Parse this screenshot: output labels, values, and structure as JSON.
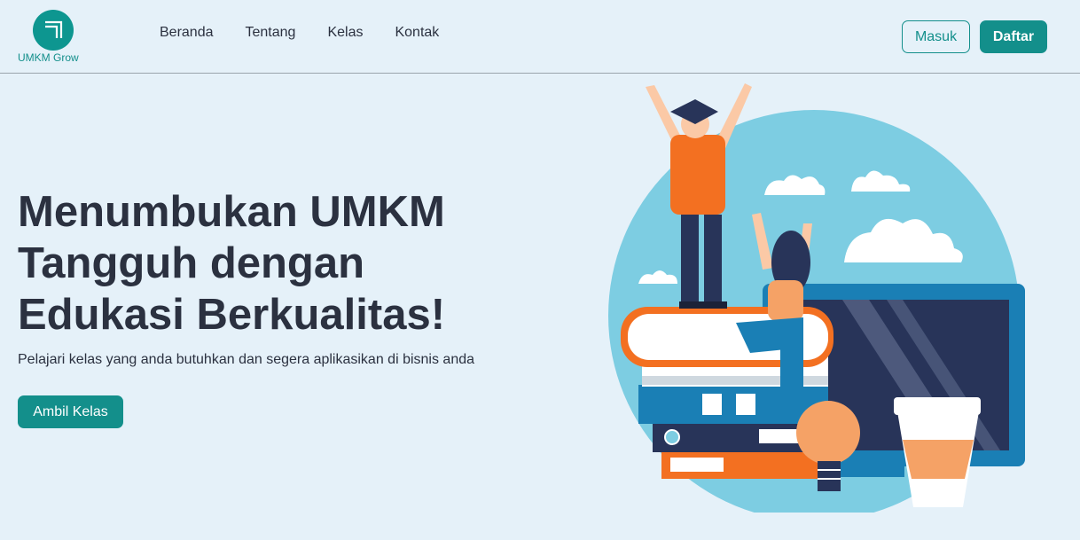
{
  "brand": {
    "name": "UMKM Grow",
    "logo_icon": "corner-arrow-logo"
  },
  "nav": {
    "items": [
      "Beranda",
      "Tentang",
      "Kelas",
      "Kontak"
    ]
  },
  "auth": {
    "login_label": "Masuk",
    "register_label": "Daftar"
  },
  "hero": {
    "title_lines": [
      "Menumbukan UMKM",
      "Tangguh dengan",
      "Edukasi Berkualitas!"
    ],
    "subtitle": "Pelajari kelas yang anda butuhkan dan segera aplikasikan di bisnis anda",
    "cta_label": "Ambil Kelas"
  },
  "colors": {
    "accent": "#138f8b",
    "background": "#e5f1f9",
    "text": "#2b3140"
  }
}
